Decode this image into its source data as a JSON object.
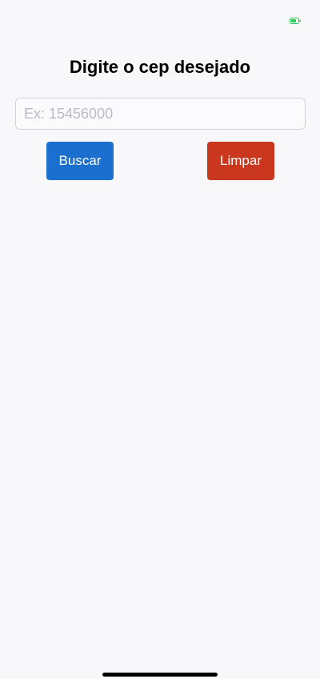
{
  "status_bar": {
    "battery_icon": "battery-charging-icon",
    "battery_color": "#34c759"
  },
  "header": {
    "title": "Digite o cep desejado"
  },
  "search": {
    "placeholder": "Ex: 15456000",
    "value": ""
  },
  "actions": {
    "search_label": "Buscar",
    "search_color": "#1a6fcf",
    "clear_label": "Limpar",
    "clear_color": "#c9381e"
  }
}
